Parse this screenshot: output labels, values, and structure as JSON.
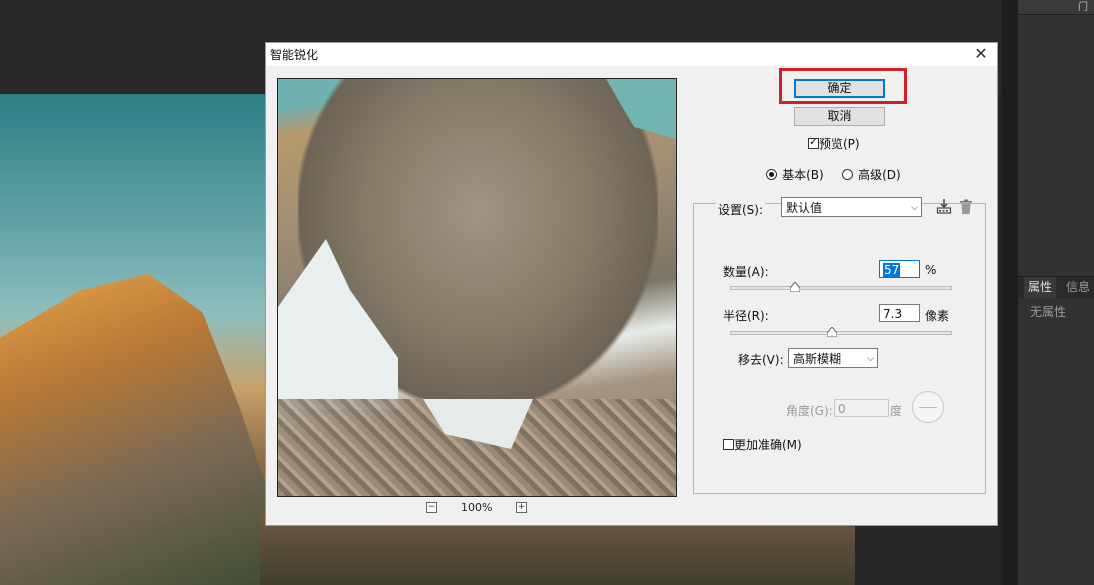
{
  "app": {
    "panel_top_label": "门",
    "properties_tab": "属性",
    "info_tab": "信息",
    "no_properties": "无属性"
  },
  "dialog": {
    "title": "智能锐化",
    "close_glyph": "✕",
    "ok_label": "确定",
    "cancel_label": "取消",
    "preview_label": "预览(P)",
    "preview_checked": true,
    "mode_basic_label": "基本(B)",
    "mode_advanced_label": "高级(D)",
    "mode_selected": "basic",
    "zoom": {
      "minus_glyph": "−",
      "value": "100%",
      "plus_glyph": "+"
    },
    "settings_label": "设置(S):",
    "settings_value": "默认值",
    "amount_label": "数量(A):",
    "amount_value": "57",
    "amount_unit": "%",
    "amount_slider_fraction": 0.29,
    "radius_label": "半径(R):",
    "radius_value": "7.3",
    "radius_unit": "像素",
    "radius_slider_fraction": 0.46,
    "remove_label": "移去(V):",
    "remove_value": "高斯模糊",
    "angle_label": "角度(G):",
    "angle_value": "0",
    "angle_unit": "度",
    "more_accurate_label": "更加准确(M)",
    "more_accurate_checked": false
  },
  "icons": {
    "save_preset": "save-preset-icon",
    "delete_preset": "trash-icon",
    "dropdown": "chevron-down-icon",
    "slider_thumb": "slider-thumb-icon"
  },
  "colors": {
    "highlight_box": "#d0202c",
    "focus_blue": "#0078d7",
    "dialog_bg": "#f0f0f0",
    "ps_dark": "#282828"
  }
}
